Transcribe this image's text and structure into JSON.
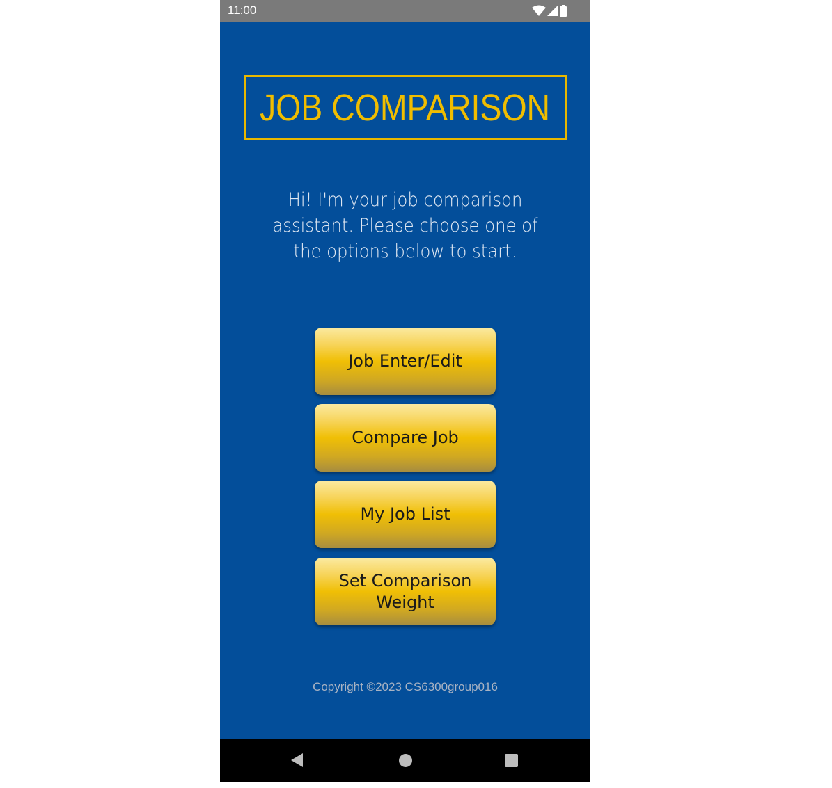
{
  "status_bar": {
    "time": "11:00",
    "icons": [
      "wifi-icon",
      "signal-icon",
      "battery-icon"
    ]
  },
  "header": {
    "title": "JOB COMPARISON"
  },
  "intro": {
    "text": "Hi! I'm your job comparison assistant. Please choose one of the options below to start."
  },
  "menu": {
    "job_enter_edit": "Job Enter/Edit",
    "compare_job": "Compare Job",
    "my_job_list": "My Job List",
    "set_comparison_weight": "Set Comparison Weight"
  },
  "footer": {
    "copyright": "Copyright ©2023 CS6300group016"
  },
  "nav_bar": {
    "icons": [
      "back-icon",
      "home-icon",
      "recents-icon"
    ]
  },
  "colors": {
    "background": "#034e9a",
    "accent": "#f0bd00",
    "status_bar": "#7a7a7a",
    "nav_bar": "#000000"
  }
}
